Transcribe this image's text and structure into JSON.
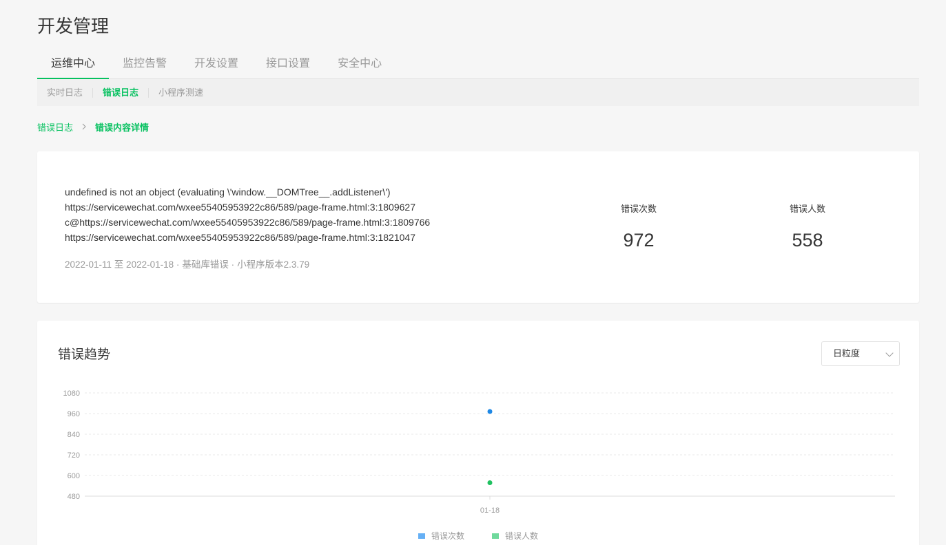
{
  "page": {
    "title": "开发管理"
  },
  "main_tabs": [
    {
      "label": "运维中心",
      "active": true
    },
    {
      "label": "监控告警",
      "active": false
    },
    {
      "label": "开发设置",
      "active": false
    },
    {
      "label": "接口设置",
      "active": false
    },
    {
      "label": "安全中心",
      "active": false
    }
  ],
  "sub_tabs": [
    {
      "label": "实时日志",
      "active": false
    },
    {
      "label": "错误日志",
      "active": true
    },
    {
      "label": "小程序测速",
      "active": false
    }
  ],
  "breadcrumb": {
    "parent": "错误日志",
    "separator": ">",
    "current": "错误内容详情"
  },
  "error": {
    "lines": [
      "undefined is not an object (evaluating \\'window.__DOMTree__.addListener\\')",
      "https://servicewechat.com/wxee55405953922c86/589/page-frame.html:3:1809627",
      "c@https://servicewechat.com/wxee55405953922c86/589/page-frame.html:3:1809766",
      "https://servicewechat.com/wxee55405953922c86/589/page-frame.html:3:1821047"
    ],
    "date_range": "2022-01-11 至  2022-01-18 ·",
    "category": "基础库错误 ·",
    "version": "小程序版本2.3.79"
  },
  "stats": {
    "error_count_label": "错误次数",
    "error_count": "972",
    "error_users_label": "错误人数",
    "error_users": "558"
  },
  "trend": {
    "title": "错误趋势",
    "granularity": "日粒度"
  },
  "chart_data": {
    "type": "scatter",
    "x": [
      "01-18"
    ],
    "series": [
      {
        "name": "错误次数",
        "values": [
          972
        ],
        "color": "#1e88e5"
      },
      {
        "name": "错误人数",
        "values": [
          558
        ],
        "color": "#1fc160"
      }
    ],
    "ylim": [
      480,
      1080
    ],
    "yticks": [
      "1080",
      "960",
      "840",
      "720",
      "600",
      "480"
    ],
    "legend_colors": [
      "#66b0f5",
      "#6fd99c"
    ],
    "grid": true,
    "legend_position": "bottom-center"
  }
}
